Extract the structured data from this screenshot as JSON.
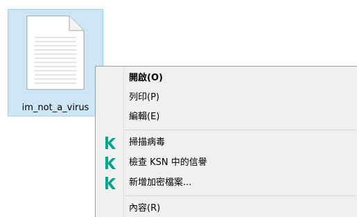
{
  "desktop": {
    "file": {
      "name": "im_not_a_virus",
      "icon": "document-icon"
    }
  },
  "context_menu": {
    "items": [
      {
        "label": "開啟(O)",
        "bold": true
      },
      {
        "label": "列印(P)"
      },
      {
        "label": "編輯(E)"
      },
      {
        "label": "掃描病毒",
        "icon": "kaspersky-icon"
      },
      {
        "label": "檢查 KSN 中的信譽",
        "icon": "kaspersky-icon"
      },
      {
        "label": "新增加密檔案...",
        "icon": "kaspersky-icon"
      },
      {
        "label": "內容(R)"
      }
    ],
    "accent_color": "#00a88e"
  }
}
